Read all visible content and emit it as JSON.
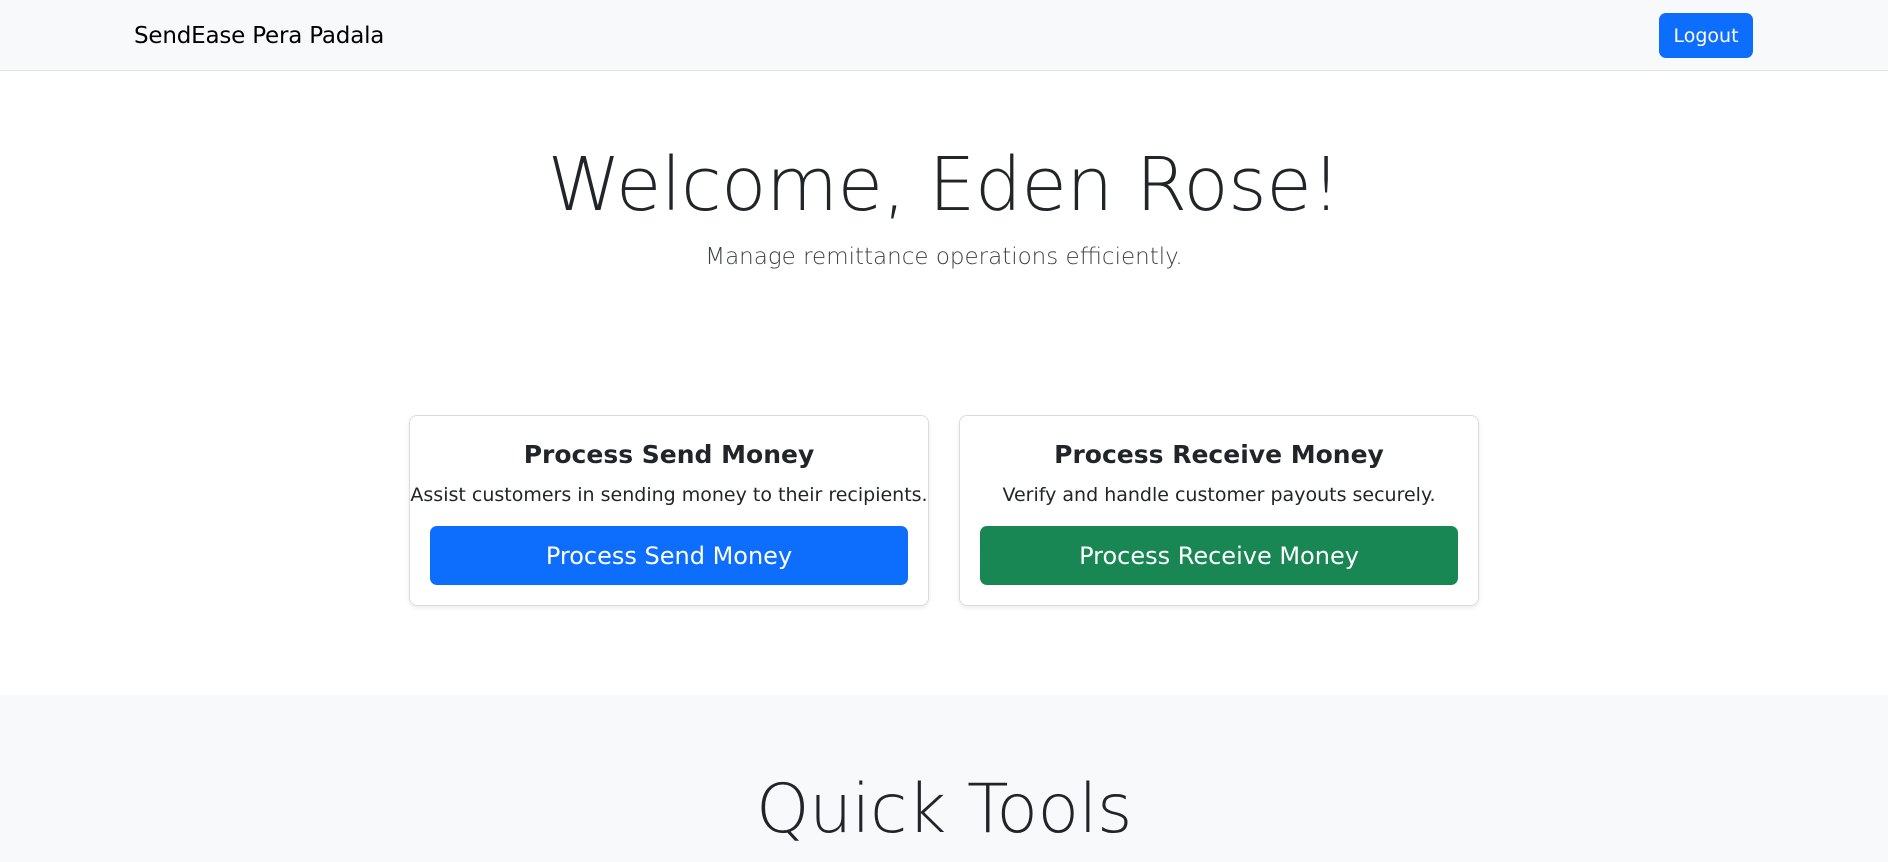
{
  "navbar": {
    "brand": "SendEase Pera Padala",
    "logout_label": "Logout"
  },
  "hero": {
    "title": "Welcome, Eden Rose!",
    "subtitle": "Manage remittance operations efficiently."
  },
  "cards": [
    {
      "title": "Process Send Money",
      "description": "Assist customers in sending money to their recipients.",
      "button_label": "Process Send Money",
      "button_color": "#0d6efd"
    },
    {
      "title": "Process Receive Money",
      "description": "Verify and handle customer payouts securely.",
      "button_label": "Process Receive Money",
      "button_color": "#198754"
    }
  ],
  "quick_tools": {
    "title": "Quick Tools"
  }
}
